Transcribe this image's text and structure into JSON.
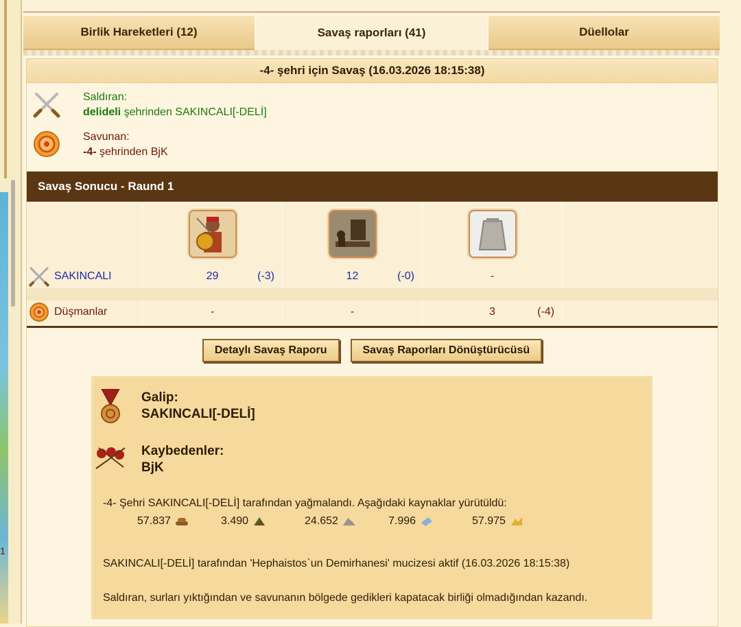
{
  "tabs": [
    {
      "label": "Birlik Hareketleri (12)",
      "active": false
    },
    {
      "label": "Savaş raporları (41)",
      "active": true
    },
    {
      "label": "Düellolar",
      "active": false
    }
  ],
  "side_number": "1",
  "report": {
    "title": "-4- şehri için Savaş (16.03.2026 18:15:38)",
    "attacker": {
      "label": "Saldıran:",
      "city": "delideli",
      "mid": " şehrinden ",
      "player": "SAKINCALI[-DELİ]"
    },
    "defender": {
      "label": "Savunan:",
      "city": "-4-",
      "mid": " şehrinden ",
      "player": "BjK"
    },
    "round_title": "Savaş Sonucu - Raund 1",
    "rows": [
      {
        "name": "SAKINCALI",
        "cells": [
          {
            "count": "29",
            "loss": "(-3)"
          },
          {
            "count": "12",
            "loss": "(-0)"
          },
          {
            "count": "-",
            "loss": ""
          }
        ]
      },
      {
        "name": "Düşmanlar",
        "cells": [
          {
            "count": "-",
            "loss": ""
          },
          {
            "count": "-",
            "loss": ""
          },
          {
            "count": "3",
            "loss": "(-4)"
          }
        ]
      }
    ],
    "buttons": {
      "detail": "Detaylı Savaş Raporu",
      "converter": "Savaş Raporları Dönüştürücüsü"
    },
    "winner_label": "Galip:",
    "winner": "SAKINCALI[-DELİ]",
    "losers_label": "Kaybedenler:",
    "losers": "BjK",
    "plunder_text": "-4- Şehri SAKINCALI[-DELİ] tarafından yağmalandı. Aşağıdaki kaynaklar yürütüldü:",
    "resources": [
      {
        "value": "57.837",
        "icon": "wood-icon"
      },
      {
        "value": "3.490",
        "icon": "grain-icon"
      },
      {
        "value": "24.652",
        "icon": "stone-icon"
      },
      {
        "value": "7.996",
        "icon": "silver-icon"
      },
      {
        "value": "57.975",
        "icon": "gold-icon"
      }
    ],
    "miracle_text": "SAKINCALI[-DELİ] tarafından 'Hephaistos`un Demirhanesi' mucizesi aktif (16.03.2026 18:15:38)",
    "conclusion_text": "Saldıran, surları yıktığından ve savunanın bölgede gedikleri kapatacak birliği olmadığından kazandı."
  }
}
